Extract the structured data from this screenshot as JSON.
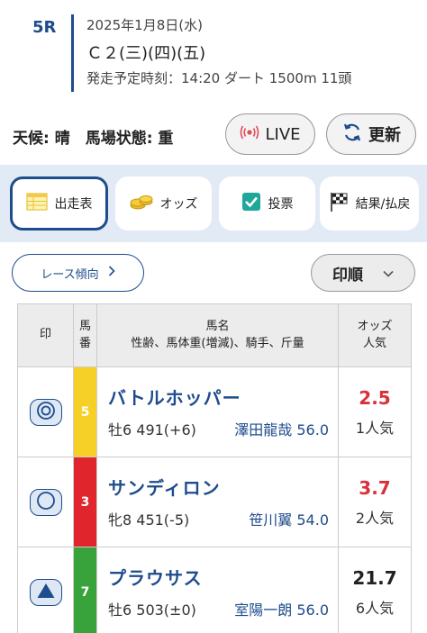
{
  "race": {
    "number": "5R",
    "date": "2025年1月8日(水)",
    "name": "Ｃ２(三)(四)(五)",
    "info": "発走予定時刻：14:20 ダート 1500m 11頭"
  },
  "conditions": "天候: 晴　馬場状態: 重",
  "buttons": {
    "live": "LIVE",
    "refresh": "更新",
    "trend": "レース傾向",
    "sort": "印順"
  },
  "tabs": [
    {
      "label": "出走表",
      "icon": "table-icon",
      "active": true
    },
    {
      "label": "オッズ",
      "icon": "coins-icon"
    },
    {
      "label": "投票",
      "icon": "checkbox-icon"
    },
    {
      "label": "結果/払戻",
      "icon": "checkered-flag-icon"
    }
  ],
  "table": {
    "headers": {
      "mark": "印",
      "number_top": "馬",
      "number_bottom": "番",
      "name_top": "馬名",
      "name_bottom": "性齢、馬体重(増減)、騎手、斤量",
      "odds_top": "オッズ",
      "odds_bottom": "人気"
    },
    "rows": [
      {
        "mark": "double-circle-icon",
        "no": "5",
        "frame_color": "#f7d027",
        "name": "バトルホッパー",
        "sub": "牡6 491(+6)",
        "jockey": "澤田龍哉 56.0",
        "odds": "2.5",
        "odds_color": "#d9303b",
        "popularity": "1人気"
      },
      {
        "mark": "circle-icon",
        "no": "3",
        "frame_color": "#e0262c",
        "name": "サンディロン",
        "sub": "牝8 451(-5)",
        "jockey": "笹川翼 54.0",
        "odds": "3.7",
        "odds_color": "#d9303b",
        "popularity": "2人気"
      },
      {
        "mark": "triangle-icon",
        "no": "7",
        "frame_color": "#37a33a",
        "name": "プラウサス",
        "sub": "牡6 503(±0)",
        "jockey": "室陽一朗 56.0",
        "odds": "21.7",
        "odds_color": "#222222",
        "popularity": "6人気"
      }
    ]
  }
}
